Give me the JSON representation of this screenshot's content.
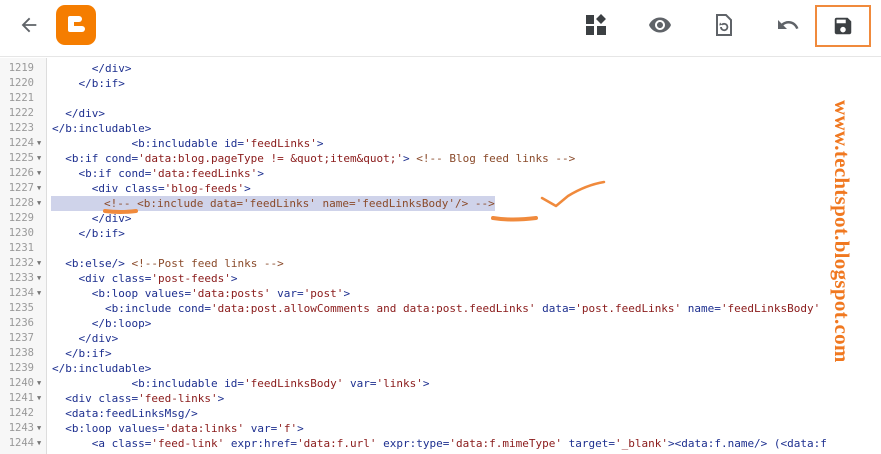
{
  "toolbar": {
    "icons": [
      "back-arrow-icon",
      "blogger-logo",
      "layout-icon",
      "preview-eye-icon",
      "revert-icon",
      "undo-icon",
      "save-icon"
    ],
    "accent": "#f57d00",
    "highlight_color": "#f08a3c"
  },
  "editor": {
    "lines": [
      {
        "n": "1219",
        "fold": false,
        "text": "      </div>"
      },
      {
        "n": "1220",
        "fold": false,
        "text": "    </b:if>"
      },
      {
        "n": "1221",
        "fold": false,
        "text": ""
      },
      {
        "n": "1222",
        "fold": false,
        "text": "  </div>"
      },
      {
        "n": "1223",
        "fold": false,
        "text": "</b:includable>"
      },
      {
        "n": "1224",
        "fold": true,
        "text": "            <b:includable id='feedLinks'>"
      },
      {
        "n": "1225",
        "fold": true,
        "text": "  <b:if cond='data:blog.pageType != &quot;item&quot;'> <!-- Blog feed links -->"
      },
      {
        "n": "1226",
        "fold": true,
        "text": "    <b:if cond='data:feedLinks'>"
      },
      {
        "n": "1227",
        "fold": true,
        "text": "      <div class='blog-feeds'>"
      },
      {
        "n": "1228",
        "fold": true,
        "text": "        <!-- <b:include data='feedLinks' name='feedLinksBody'/> -->",
        "highlight": true
      },
      {
        "n": "1229",
        "fold": false,
        "text": "      </div>"
      },
      {
        "n": "1230",
        "fold": false,
        "text": "    </b:if>"
      },
      {
        "n": "1231",
        "fold": false,
        "text": ""
      },
      {
        "n": "1232",
        "fold": true,
        "text": "  <b:else/> <!--Post feed links -->"
      },
      {
        "n": "1233",
        "fold": true,
        "text": "    <div class='post-feeds'>"
      },
      {
        "n": "1234",
        "fold": true,
        "text": "      <b:loop values='data:posts' var='post'>"
      },
      {
        "n": "1235",
        "fold": false,
        "text": "        <b:include cond='data:post.allowComments and data:post.feedLinks' data='post.feedLinks' name='feedLinksBody'"
      },
      {
        "n": "1236",
        "fold": false,
        "text": "      </b:loop>"
      },
      {
        "n": "1237",
        "fold": false,
        "text": "    </div>"
      },
      {
        "n": "1238",
        "fold": false,
        "text": "  </b:if>"
      },
      {
        "n": "1239",
        "fold": false,
        "text": "</b:includable>"
      },
      {
        "n": "1240",
        "fold": true,
        "text": "            <b:includable id='feedLinksBody' var='links'>"
      },
      {
        "n": "1241",
        "fold": true,
        "text": "  <div class='feed-links'>"
      },
      {
        "n": "1242",
        "fold": false,
        "text": "  <data:feedLinksMsg/>"
      },
      {
        "n": "1243",
        "fold": true,
        "text": "  <b:loop values='data:links' var='f'>"
      },
      {
        "n": "1244",
        "fold": true,
        "text": "      <a class='feed-link' expr:href='data:f.url' expr:type='data:f.mimeType' target='_blank'><data:f.name/> (<data:f"
      }
    ]
  },
  "watermark": {
    "text": "www.techtspot.blogspot.com",
    "color": "#f07820"
  }
}
